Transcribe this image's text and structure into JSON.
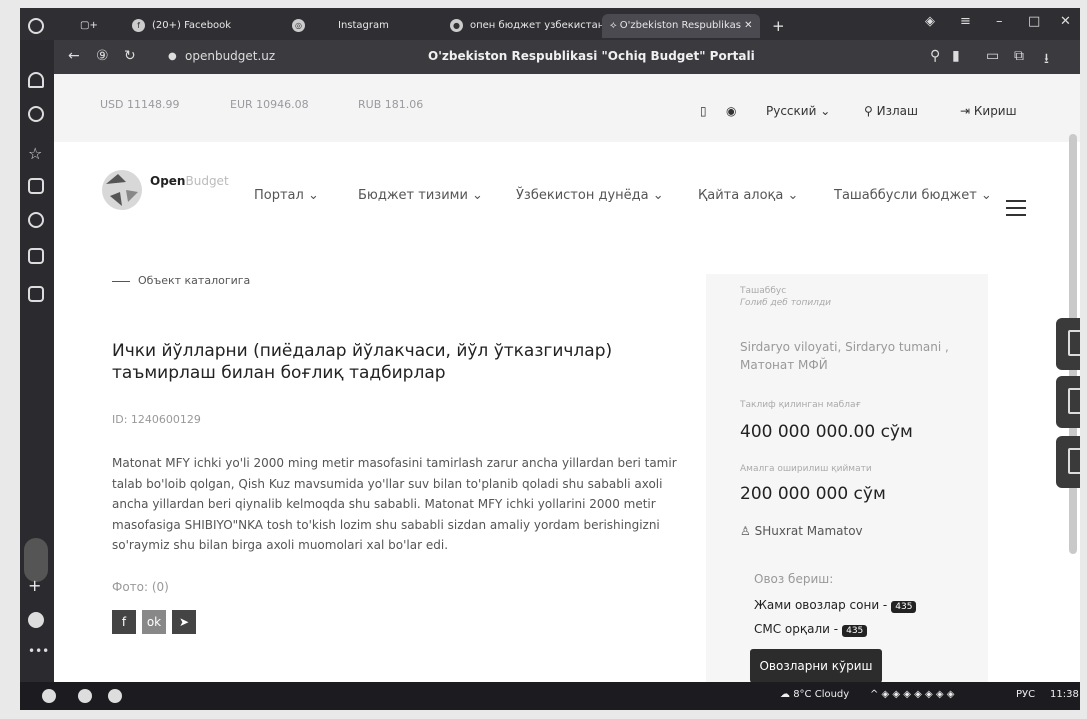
{
  "browser": {
    "tabs": [
      {
        "label": "(20+) Facebook",
        "icon": "facebook-icon"
      },
      {
        "label": "Instagram",
        "icon": "instagram-icon"
      },
      {
        "label": "опен бюджет узбекистан",
        "icon": "search-icon"
      },
      {
        "label": "O'zbekiston Respublikas",
        "icon": "openbudget-icon",
        "active": true
      }
    ],
    "url": "openbudget.uz",
    "page_title": "O'zbekiston Respublikasi \"Ochiq Budget\" Portali",
    "window_controls": [
      "minimize-icon",
      "maximize-icon",
      "close-icon"
    ]
  },
  "site": {
    "rates": {
      "usd": "USD 11148.99",
      "eur": "EUR 10946.08",
      "rub": "RUB 181.06"
    },
    "language": "Русский",
    "search_label": "Излаш",
    "login_label": "Кириш",
    "logo": {
      "name": "Open",
      "name_light": "Budget"
    },
    "nav": [
      {
        "label": "Портал"
      },
      {
        "label": "Бюджет тизими"
      },
      {
        "label": "Ўзбекистон дунёда"
      },
      {
        "label": "Қайта алоқа"
      },
      {
        "label": "Ташаббусли бюджет"
      }
    ]
  },
  "main": {
    "breadcrumb": "Объект каталогига",
    "title": "Ички йўлларни (пиёдалар йўлакчаси, йўл ўтказгичлар) таъмирлаш билан боғлиқ тадбирлар",
    "id_line": "ID: 1240600129",
    "description": "Matonat MFY ichki yo'li 2000 ming metir masofasini tamirlash zarur ancha yillardan beri tamir talab bo'loib qolgan, Qish Kuz mavsumida yo'llar suv bilan to'planib qoladi shu sababli axoli ancha yillardan beri qiynalib kelmoqda shu sababli. Matonat MFY ichki yollarini 2000 metir masofasiga SHIBIYO\"NKA tosh to'kish lozim shu sababli sizdan amaliy yordam berishingizni so'raymiz shu bilan birga axoli muomolari xal bo'lar edi.",
    "photo_label": "Фото: (0)"
  },
  "info": {
    "initiative_label": "Ташаббус",
    "initiative_sub": "Голиб деб топилди",
    "location": "Sirdaryo viloyati, Sirdaryo tumani , Матонат МФЙ",
    "proposed_label": "Таклиф қилинган маблағ",
    "proposed_amount": "400 000 000.00 сўм",
    "implemented_label": "Амалга оширилиш қиймати",
    "implemented_amount": "200 000 000 сўм",
    "author": "SHuxrat Mamatov",
    "vote_label": "Овоз бериш:",
    "total_votes_label": "Жами овозлар сони -",
    "total_votes": "435",
    "sms_votes_label": "СМС орқали -",
    "sms_votes": "435",
    "vote_button": "Овозларни кўриш"
  },
  "taskbar": {
    "weather": "8°C Cloudy",
    "lang": "РУС",
    "time": "11:38"
  }
}
